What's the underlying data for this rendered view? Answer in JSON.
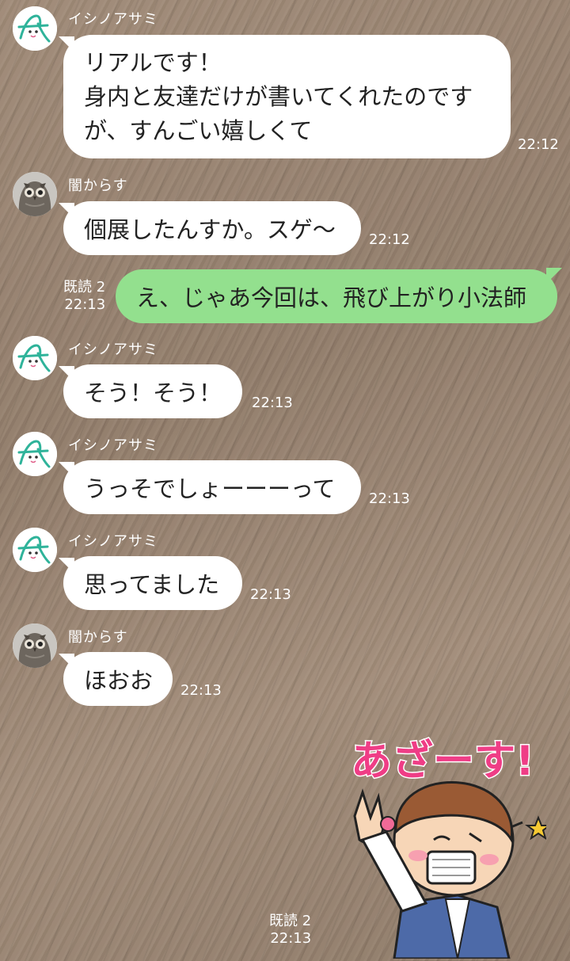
{
  "messages": [
    {
      "sender": "イシノアサミ",
      "text": "リアルです！\n身内と友達だけが書いてくれたのです\nが、すんごい嬉しくて",
      "time": "22:12"
    },
    {
      "sender": "闇からす",
      "text": "個展したんすか。スゲ〜",
      "time": "22:12"
    },
    {
      "read": "既読 2",
      "text": "え、じゃあ今回は、飛び上がり小法師",
      "time": "22:13"
    },
    {
      "sender": "イシノアサミ",
      "text": "そう！そう！",
      "time": "22:13"
    },
    {
      "sender": "イシノアサミ",
      "text": "うっそでしょーーーって",
      "time": "22:13"
    },
    {
      "sender": "イシノアサミ",
      "text": "思ってました",
      "time": "22:13"
    },
    {
      "sender": "闇からす",
      "text": "ほおお",
      "time": "22:13"
    },
    {
      "read": "既読 2",
      "time": "22:13",
      "sticker_text": "あざーす!"
    }
  ],
  "colors": {
    "incoming": "#ffffff",
    "outgoing": "#93e08e",
    "sticker_text": "#ef3d86"
  },
  "icons": [
    "leaf-logo-avatar",
    "owl-avatar",
    "bowing-character-sticker"
  ]
}
